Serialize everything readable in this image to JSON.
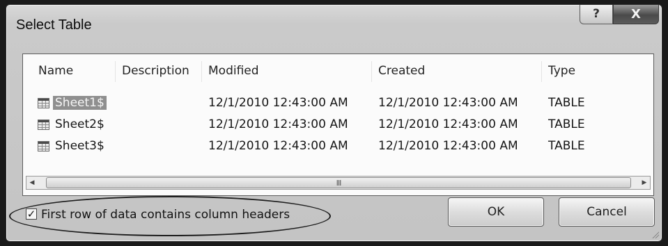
{
  "dialog": {
    "title": "Select Table",
    "help_glyph": "?",
    "close_glyph": "X"
  },
  "table": {
    "columns": [
      "Name",
      "Description",
      "Modified",
      "Created",
      "Type"
    ],
    "rows": [
      {
        "name": "Sheet1$",
        "description": "",
        "modified": "12/1/2010 12:43:00 AM",
        "created": "12/1/2010 12:43:00 AM",
        "type": "TABLE",
        "selected": true
      },
      {
        "name": "Sheet2$",
        "description": "",
        "modified": "12/1/2010 12:43:00 AM",
        "created": "12/1/2010 12:43:00 AM",
        "type": "TABLE",
        "selected": false
      },
      {
        "name": "Sheet3$",
        "description": "",
        "modified": "12/1/2010 12:43:00 AM",
        "created": "12/1/2010 12:43:00 AM",
        "type": "TABLE",
        "selected": false
      }
    ],
    "row_icon": "table-icon"
  },
  "scrollbar": {
    "grip_glyph": "III"
  },
  "options": {
    "first_row_headers_label": "First row of data contains column headers",
    "first_row_headers_checked": true
  },
  "buttons": {
    "ok_label": "OK",
    "cancel_label": "Cancel"
  }
}
